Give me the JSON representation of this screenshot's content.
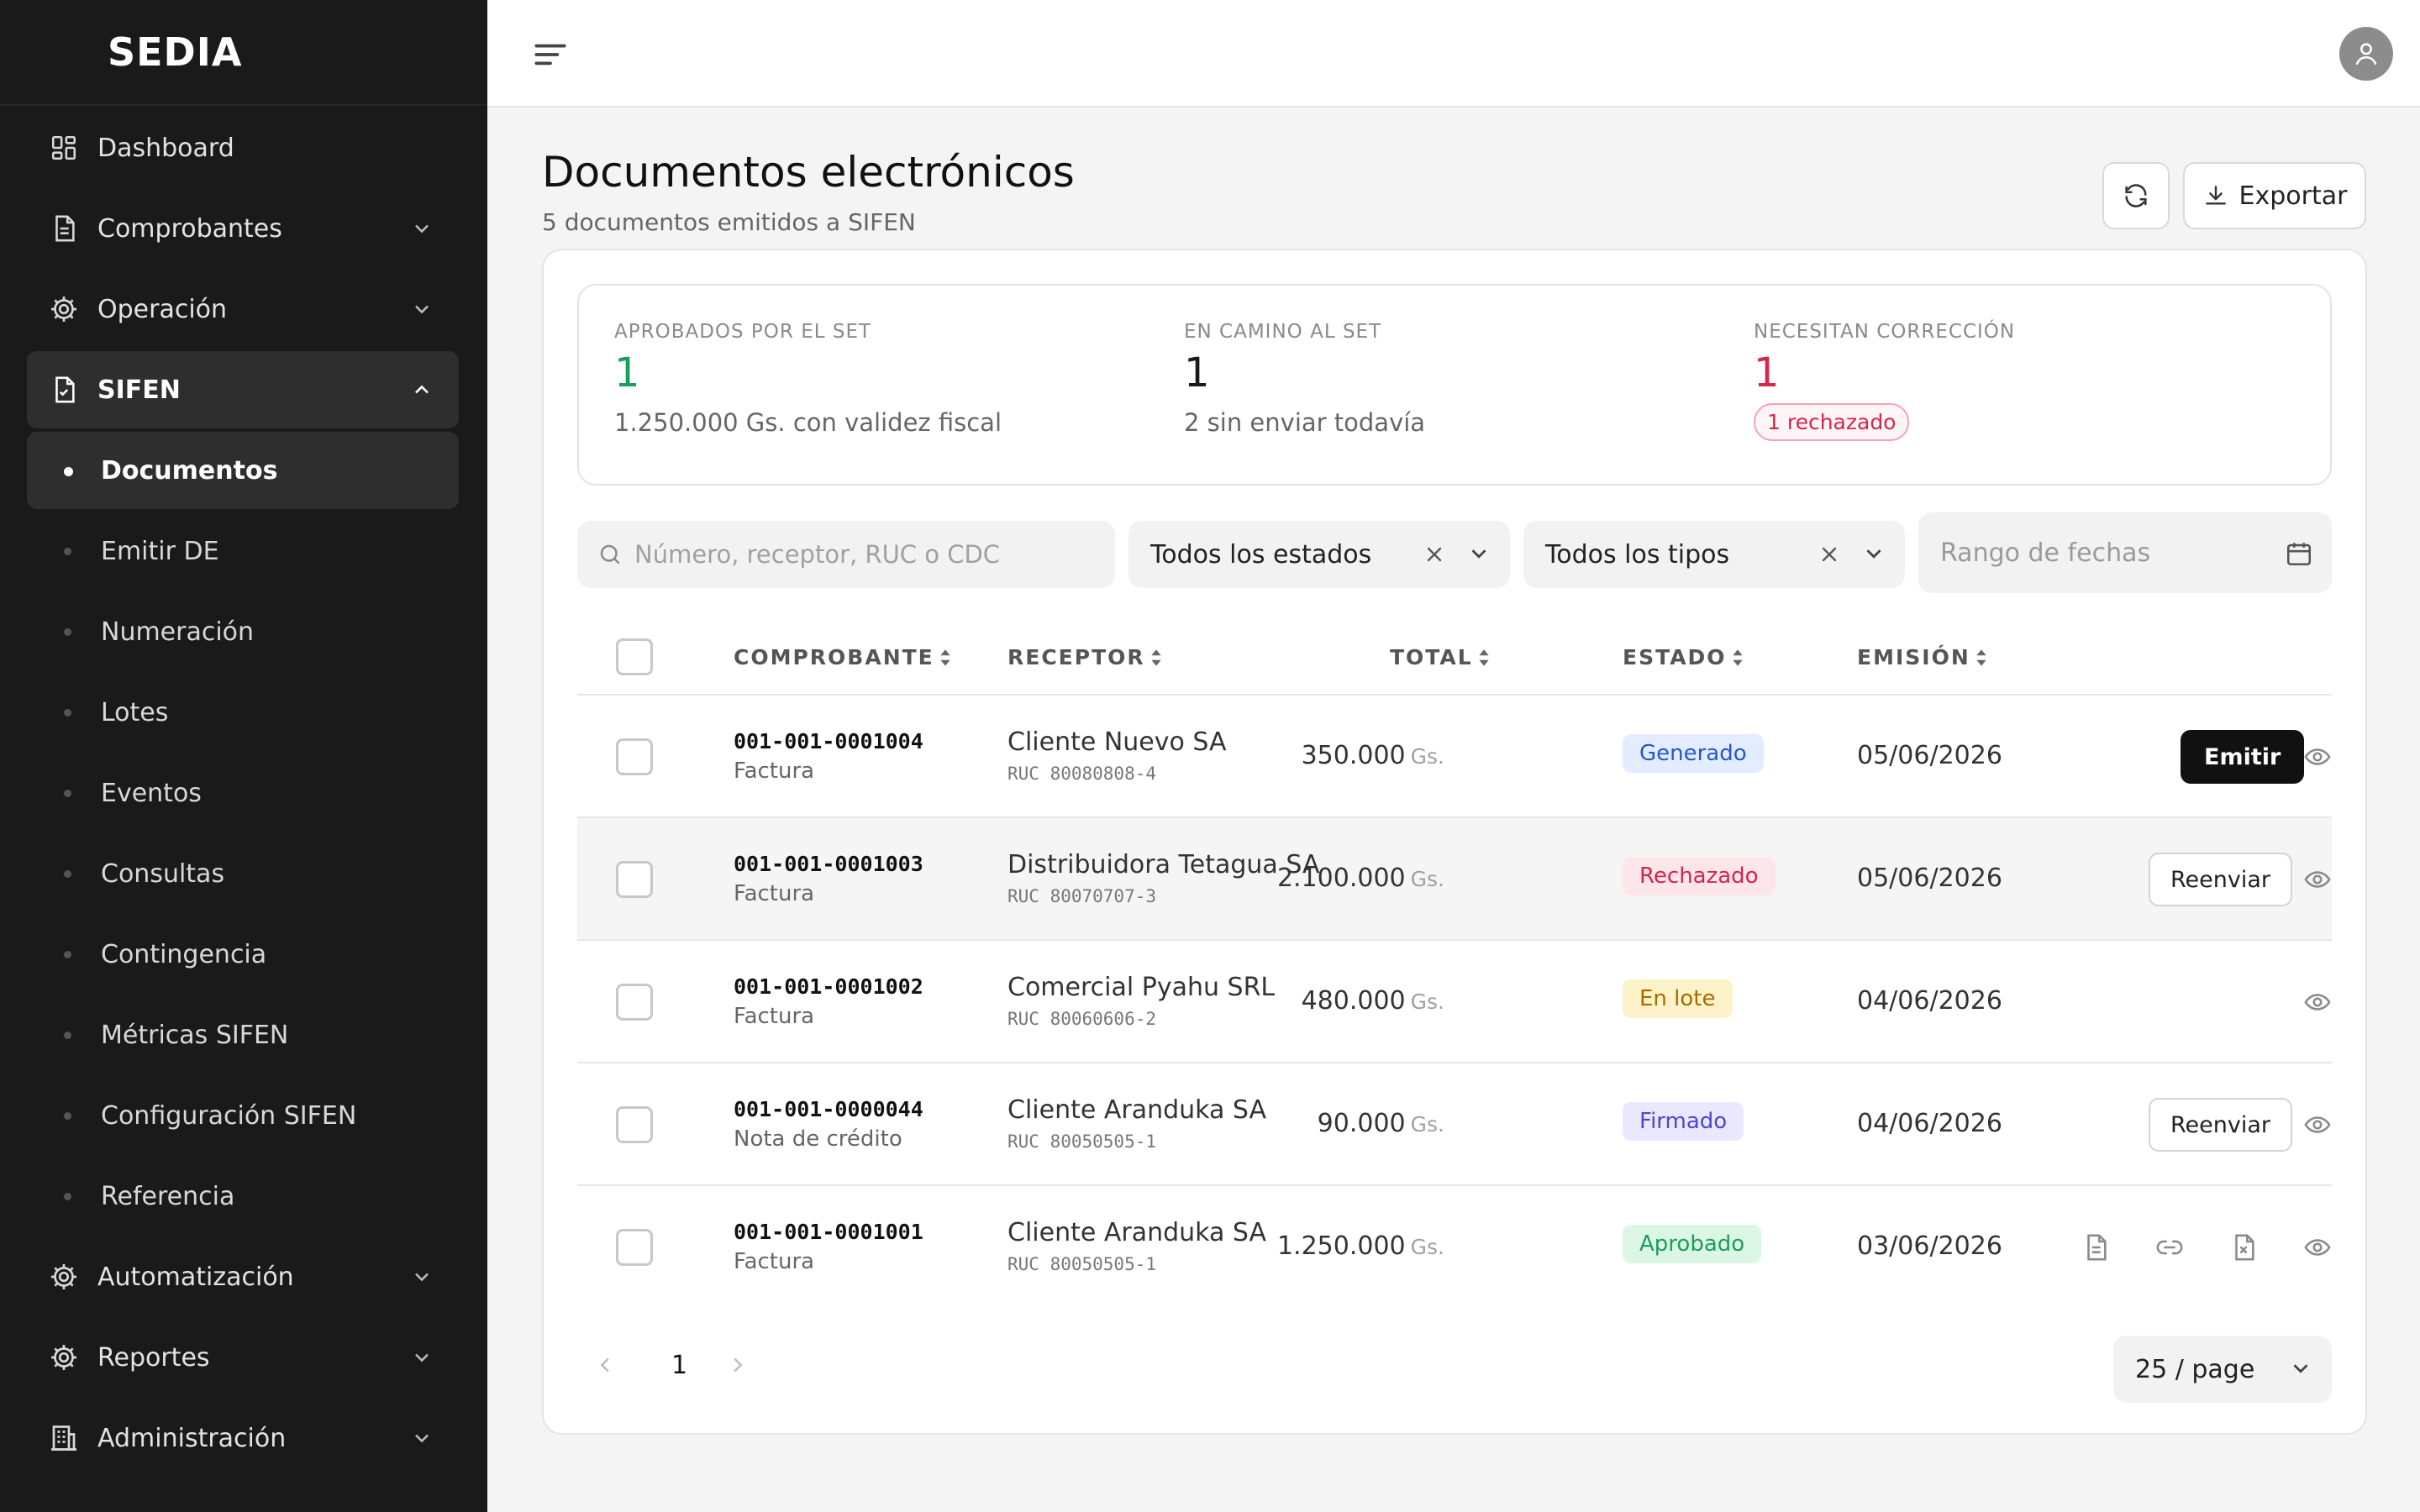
{
  "brand": "SEDIA",
  "sidebar": {
    "items": [
      {
        "label": "Dashboard",
        "icon": "dashboard-grid-icon"
      },
      {
        "label": "Comprobantes",
        "icon": "document-icon"
      },
      {
        "label": "Operación",
        "icon": "gear-icon"
      },
      {
        "label": "SIFEN",
        "icon": "document-check-icon"
      }
    ],
    "sifen_subitems": [
      {
        "label": "Documentos",
        "active": true
      },
      {
        "label": "Emitir DE"
      },
      {
        "label": "Numeración"
      },
      {
        "label": "Lotes"
      },
      {
        "label": "Eventos"
      },
      {
        "label": "Consultas"
      },
      {
        "label": "Contingencia"
      },
      {
        "label": "Métricas SIFEN"
      },
      {
        "label": "Configuración SIFEN"
      },
      {
        "label": "Referencia"
      }
    ],
    "bottom_items": [
      {
        "label": "Automatización",
        "icon": "gear-icon"
      },
      {
        "label": "Reportes",
        "icon": "gear-icon"
      },
      {
        "label": "Administración",
        "icon": "building-icon"
      }
    ]
  },
  "header": {
    "title": "Documentos electrónicos",
    "subtitle": "5 documentos emitidos a SIFEN",
    "export_label": "Exportar"
  },
  "stats": {
    "approved": {
      "label": "APROBADOS POR EL SET",
      "value": "1",
      "desc": "1.250.000 Gs. con validez fiscal",
      "color": "#1a9e5c"
    },
    "in_transit": {
      "label": "EN CAMINO AL SET",
      "value": "1",
      "desc": "2 sin enviar todavía",
      "color": "#1a1a1a"
    },
    "need_fix": {
      "label": "NECESITAN CORRECCIÓN",
      "value": "1",
      "badge": "1 rechazado",
      "color": "#d4264d"
    }
  },
  "filters": {
    "search_placeholder": "Número, receptor, RUC o CDC",
    "status_value": "Todos los estados",
    "type_value": "Todos los tipos",
    "date_placeholder": "Rango de fechas"
  },
  "table": {
    "columns": [
      "COMPROBANTE",
      "RECEPTOR",
      "TOTAL",
      "ESTADO",
      "EMISIÓN"
    ],
    "currency": "Gs.",
    "rows": [
      {
        "number": "001-001-0001004",
        "type": "Factura",
        "receptor": "Cliente Nuevo SA",
        "ruc": "RUC 80080808-4",
        "total": "350.000",
        "status": "Generado",
        "date": "05/06/2026",
        "action": "Emitir"
      },
      {
        "number": "001-001-0001003",
        "type": "Factura",
        "receptor": "Distribuidora Tetagua SA",
        "ruc": "RUC 80070707-3",
        "total": "2.100.000",
        "status": "Rechazado",
        "date": "05/06/2026",
        "action": "Reenviar"
      },
      {
        "number": "001-001-0001002",
        "type": "Factura",
        "receptor": "Comercial Pyahu SRL",
        "ruc": "RUC 80060606-2",
        "total": "480.000",
        "status": "En lote",
        "date": "04/06/2026",
        "action": ""
      },
      {
        "number": "001-001-0000044",
        "type": "Nota de crédito",
        "receptor": "Cliente Aranduka SA",
        "ruc": "RUC 80050505-1",
        "total": "90.000",
        "status": "Firmado",
        "date": "04/06/2026",
        "action": "Reenviar"
      },
      {
        "number": "001-001-0001001",
        "type": "Factura",
        "receptor": "Cliente Aranduka SA",
        "ruc": "RUC 80050505-1",
        "total": "1.250.000",
        "status": "Aprobado",
        "date": "03/06/2026",
        "action": ""
      }
    ]
  },
  "status_colors": {
    "Generado": {
      "bg": "#e3edff",
      "fg": "#2456d6"
    },
    "Rechazado": {
      "bg": "#fde6ea",
      "fg": "#d4264d"
    },
    "En lote": {
      "bg": "#fdf3c8",
      "fg": "#a86b00"
    },
    "Firmado": {
      "bg": "#e9e8ff",
      "fg": "#4d45d6"
    },
    "Aprobado": {
      "bg": "#dcf6e6",
      "fg": "#1a9e5c"
    }
  },
  "pagination": {
    "current_page": "1",
    "page_size": "25 / page"
  }
}
